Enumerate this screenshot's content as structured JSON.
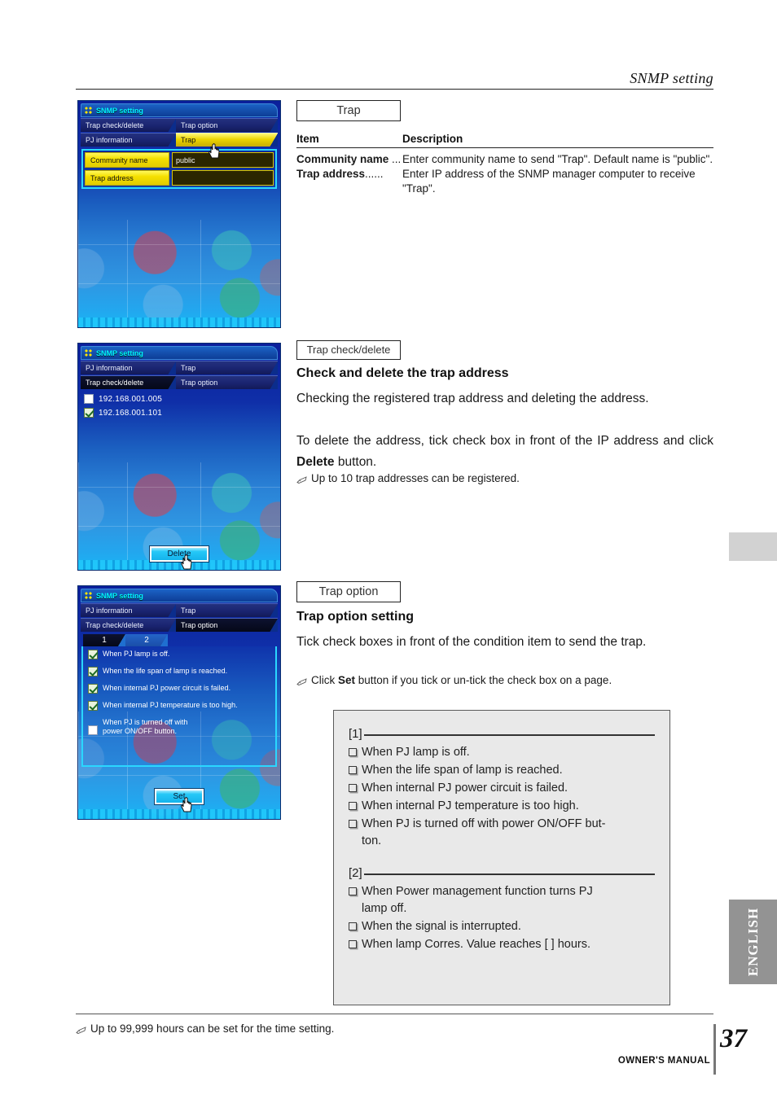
{
  "header": {
    "title": "SNMP setting"
  },
  "side": {
    "language_tab": "ENGLISH"
  },
  "panel1": {
    "window_title": "SNMP setting",
    "tabs_row1": [
      "Trap check/delete",
      "Trap option"
    ],
    "tabs_row2": [
      "PJ information",
      "Trap"
    ],
    "active_tab": "Trap",
    "fields": [
      {
        "label": "Community name",
        "value": "public"
      },
      {
        "label": "Trap address",
        "value": ""
      }
    ]
  },
  "panel2": {
    "window_title": "SNMP setting",
    "tabs_row1": [
      "PJ information",
      "Trap"
    ],
    "tabs_row2": [
      "Trap check/delete",
      "Trap option"
    ],
    "active_tab": "Trap check/delete",
    "addresses": [
      {
        "value": "192.168.001.005",
        "checked": false
      },
      {
        "value": "192.168.001.101",
        "checked": true
      }
    ],
    "button": "Delete"
  },
  "panel3": {
    "window_title": "SNMP setting",
    "tabs_row1": [
      "PJ information",
      "Trap"
    ],
    "tabs_row2": [
      "Trap check/delete",
      "Trap option"
    ],
    "active_tab": "Trap option",
    "subtabs": [
      "1",
      "2"
    ],
    "active_subtab": "1",
    "options": [
      {
        "text": "When PJ lamp is off.",
        "checked": true
      },
      {
        "text": "When the life span of lamp is reached.",
        "checked": true
      },
      {
        "text": "When internal PJ power circuit is failed.",
        "checked": true
      },
      {
        "text": "When internal PJ temperature is too high.",
        "checked": true
      },
      {
        "text": "When PJ is turned off with\npower ON/OFF button.",
        "checked": false
      }
    ],
    "button": "Set"
  },
  "section1": {
    "callout": "Trap",
    "table": {
      "headers": [
        "Item",
        "Description"
      ],
      "rows": [
        {
          "item": "Community name",
          "dots": " ...",
          "description": "Enter community name to send \"Trap\". Default name is \"public\"."
        },
        {
          "item": "Trap address",
          "dots": "......",
          "description": "Enter IP address of the SNMP manager computer to receive \"Trap\"."
        }
      ]
    }
  },
  "section2": {
    "callout": "Trap check/delete",
    "title": "Check and delete the trap address",
    "para1": "Checking the registered trap address and deleting the address.",
    "para2_pre": "To delete the address, tick check box in front of the IP address and click ",
    "para2_bold": "Delete",
    "para2_post": " button.",
    "note": "Up to 10 trap addresses can be registered."
  },
  "section3": {
    "callout": "Trap option",
    "title": "Trap option setting",
    "para1": "Tick check boxes in front of the condition item to send the trap.",
    "note_pre": "Click ",
    "note_bold": "Set",
    "note_post": " button if you tick or un-tick the check box on a page."
  },
  "info_box": {
    "group1_label": "[1]",
    "group1_items": [
      "When PJ lamp is off.",
      "When the life span of lamp is reached.",
      "When internal PJ power circuit is failed.",
      "When internal PJ temperature is too high.",
      "When PJ is turned off with power ON/OFF but-\nton."
    ],
    "group2_label": "[2]",
    "group2_items": [
      "When Power management function turns PJ\nlamp off.",
      "When the signal is interrupted.",
      "When lamp Corres. Value reaches [     ] hours."
    ]
  },
  "footer": {
    "note": "Up to 99,999 hours can be set for the time setting.",
    "manual": "OWNER'S MANUAL",
    "page_number": "37"
  }
}
